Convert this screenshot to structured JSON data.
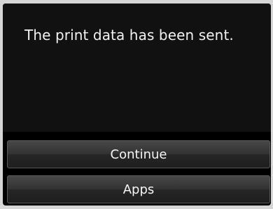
{
  "message": {
    "text": "The print data has been sent."
  },
  "buttons": {
    "continue_label": "Continue",
    "apps_label": "Apps"
  },
  "colors": {
    "screen_background": "#111111",
    "button_gradient_top": "#484848",
    "button_gradient_bottom": "#1e1e1e",
    "text": "#f2f2f2",
    "bezel": "#d6d6d6"
  }
}
